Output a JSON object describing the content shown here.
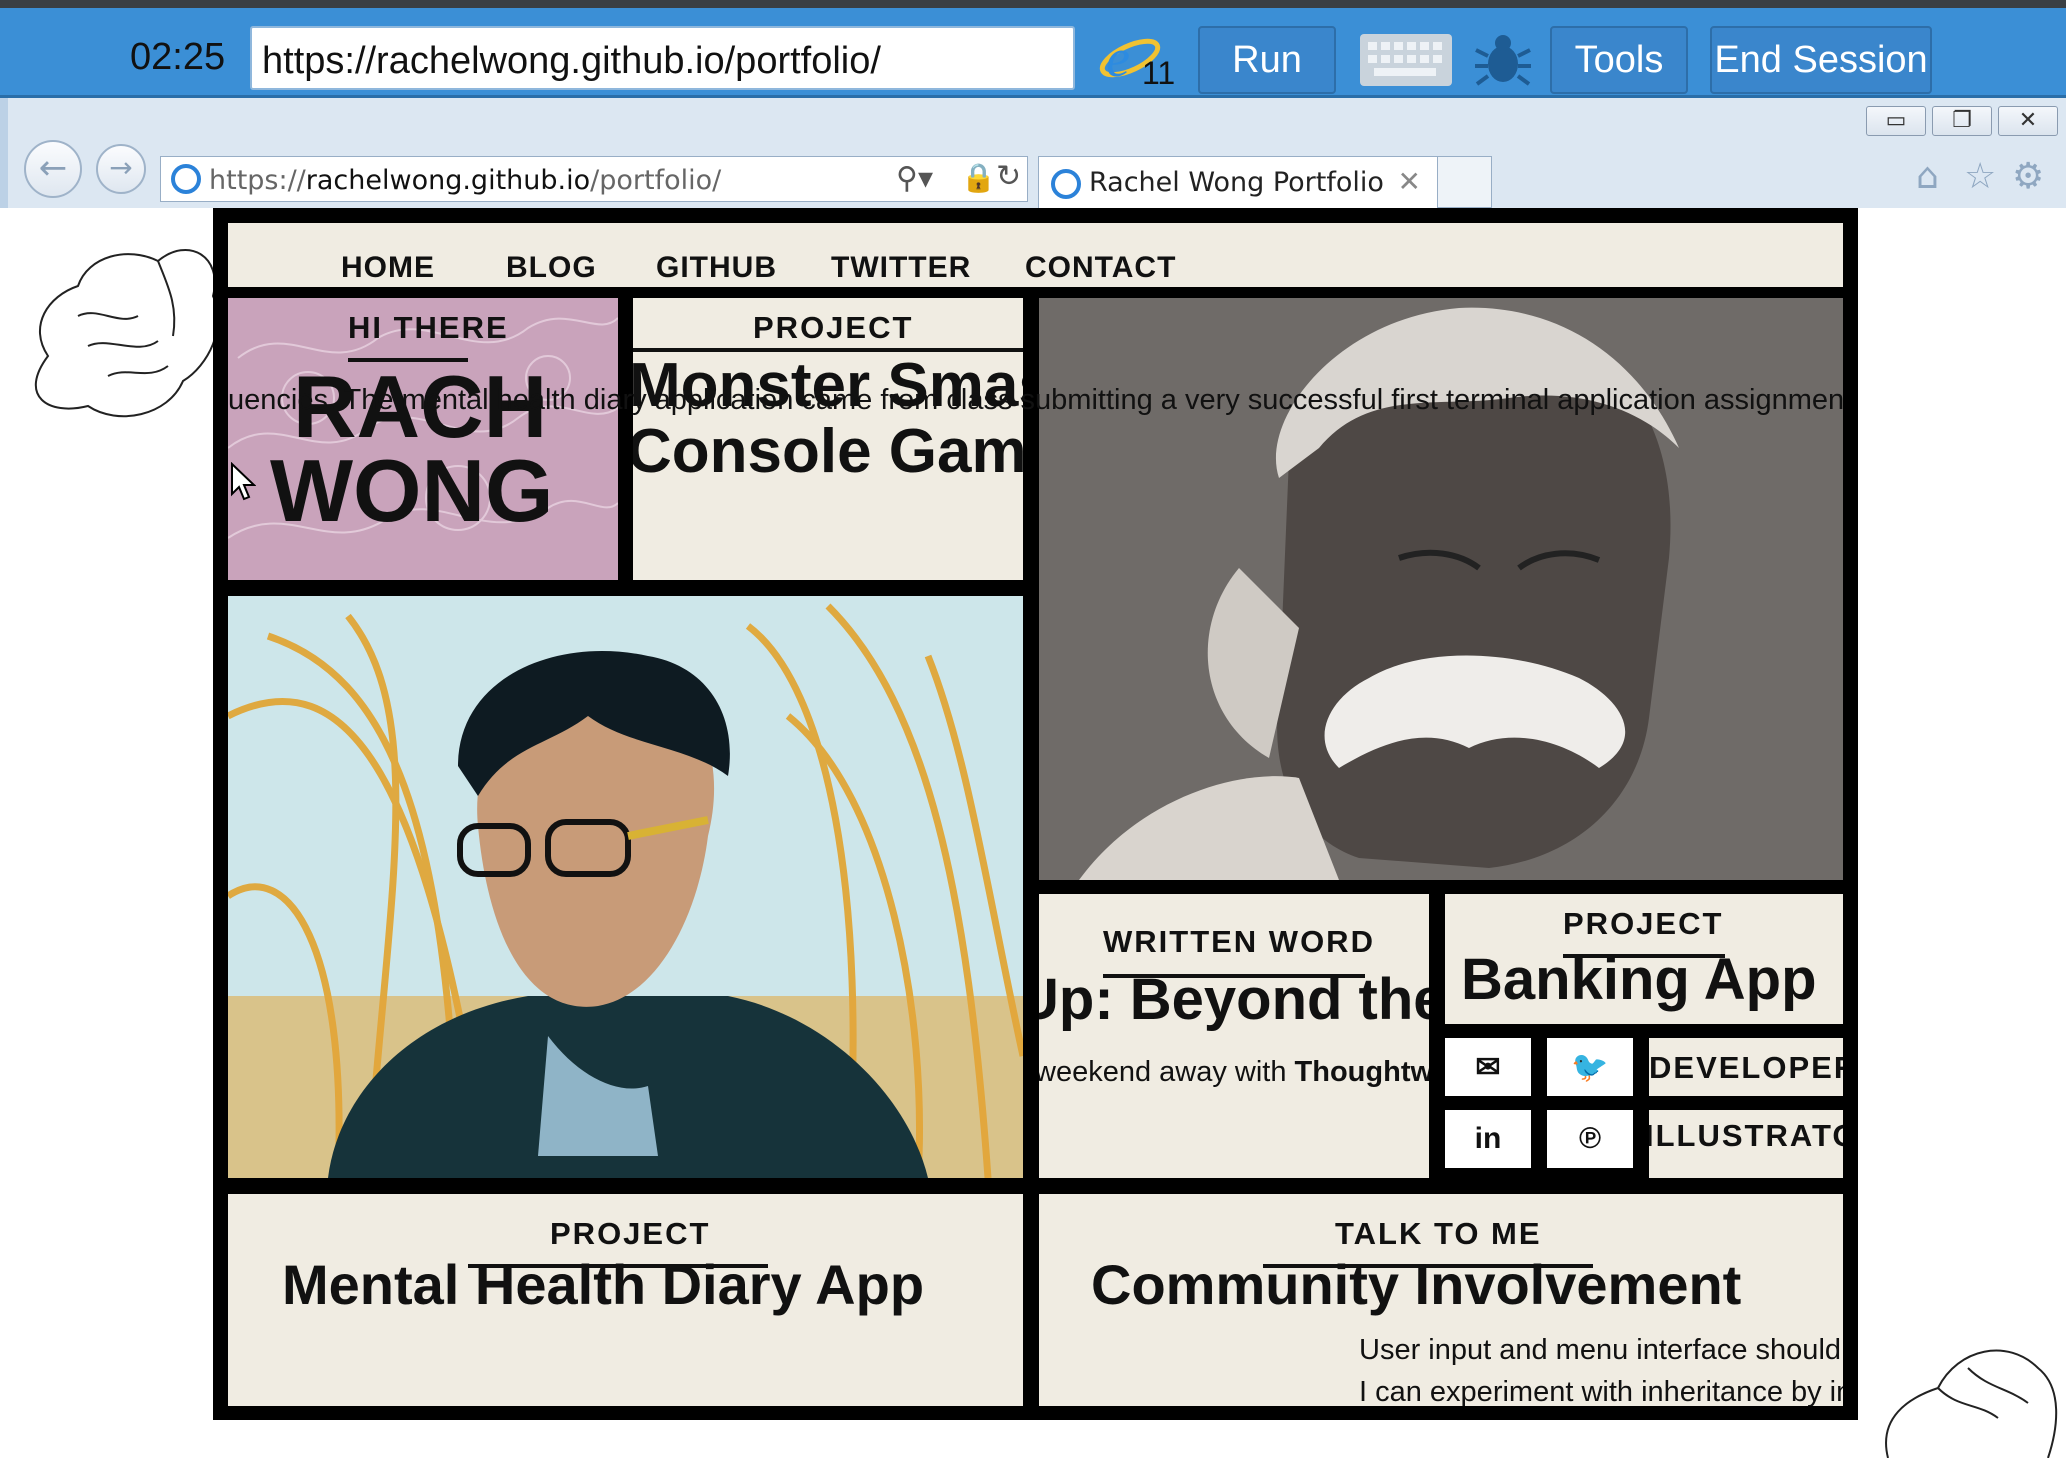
{
  "session": {
    "timer": "02:25",
    "url": "https://rachelwong.github.io/portfolio/",
    "ie_version": "11",
    "run_label": "Run",
    "tools_label": "Tools",
    "end_label": "End Session"
  },
  "browser": {
    "address_prefix": "https://",
    "address_host": "rachelwong.github.io",
    "address_path": "/portfolio/",
    "tab_title": "Rachel Wong Portfolio"
  },
  "nav": [
    "HOME",
    "BLOG",
    "GITHUB",
    "TWITTER",
    "CONTACT"
  ],
  "hero": {
    "kicker": "HI THERE",
    "line1": "RACH",
    "line2": "WONG"
  },
  "project1": {
    "kicker": "PROJECT",
    "line1": "Monster Smash",
    "line2": "Console Game"
  },
  "marquee": "uencies. The mental health diary application came from class submitting a very successful first terminal application assignmen",
  "written": {
    "kicker": "WRITTEN WORD",
    "title": "Up: Beyond the",
    "sub_pre": "weekend away with ",
    "sub_bold": "Thoughtwo"
  },
  "banking": {
    "kicker": "PROJECT",
    "title": "Banking App"
  },
  "social": {
    "email": "✉",
    "twitter": "🐦",
    "linkedin": "in",
    "pinterest": "℗",
    "role1": "DEVELOPER",
    "role2": "ILLUSTRATO"
  },
  "mental": {
    "kicker": "PROJECT",
    "title": "Mental Health Diary App"
  },
  "community": {
    "kicker": "TALK TO ME",
    "title": "Community Involvement",
    "line1": "User input and menu interface should",
    "line2": "I can experiment with inheritance by in"
  }
}
